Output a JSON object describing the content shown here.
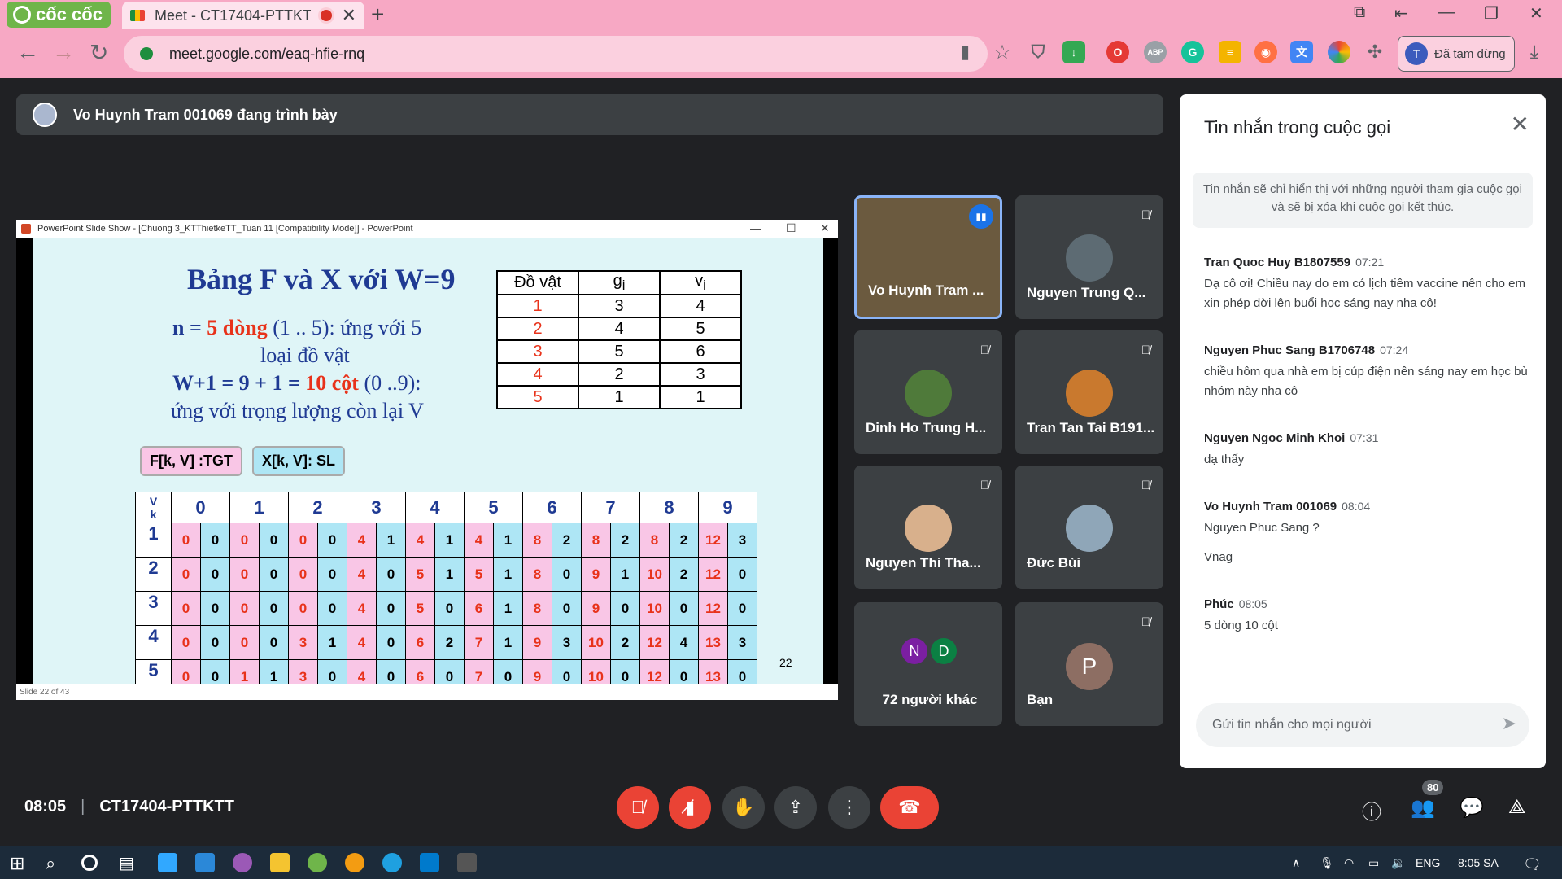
{
  "browser": {
    "brand": "cốc cốc",
    "tab_title": "Meet - CT17404-PTTKTT",
    "url": "meet.google.com/eaq-hfie-rnq",
    "profile_initial": "T",
    "profile_status": "Đã tạm dừng",
    "ext_abp": "ABP"
  },
  "meet": {
    "presenting": "Vo Huynh Tram 001069 đang trình bày",
    "time": "08:05",
    "meeting_code": "CT17404-PTTKTT",
    "participants_badge": "80"
  },
  "slide_window": {
    "title": "PowerPoint Slide Show - [Chuong 3_KTThietkeTT_Tuan 11 [Compatibility Mode]] - PowerPoint",
    "status": "Slide 22 of 43",
    "title_text": "Bảng F và X với W=9",
    "line1a": "n = ",
    "line1b": "5 dòng",
    "line1c": " (1 .. 5): ứng với 5",
    "line2": "loại đồ vật",
    "line3a": "W+1 = 9 + 1 = ",
    "line3b": "10 cột",
    "line3c": " (0 ..9):",
    "line4": "ứng với trọng lượng còn lại V",
    "callout_f": "F[k, V] :TGT",
    "callout_x": "X[k, V]: SL",
    "corner_v": "V",
    "corner_k": "k",
    "slide_number": "22",
    "items_header": [
      "Đồ vật",
      "g",
      "v"
    ],
    "items_sub": "i",
    "items": [
      [
        "1",
        "3",
        "4"
      ],
      [
        "2",
        "4",
        "5"
      ],
      [
        "3",
        "5",
        "6"
      ],
      [
        "4",
        "2",
        "3"
      ],
      [
        "5",
        "1",
        "1"
      ]
    ],
    "fx_cols": [
      "0",
      "1",
      "2",
      "3",
      "4",
      "5",
      "6",
      "7",
      "8",
      "9"
    ],
    "fx_rows": [
      {
        "k": "1",
        "cells": [
          "0",
          "0",
          "0",
          "0",
          "0",
          "0",
          "4",
          "1",
          "4",
          "1",
          "4",
          "1",
          "8",
          "2",
          "8",
          "2",
          "8",
          "2",
          "12",
          "3"
        ]
      },
      {
        "k": "2",
        "cells": [
          "0",
          "0",
          "0",
          "0",
          "0",
          "0",
          "4",
          "0",
          "5",
          "1",
          "5",
          "1",
          "8",
          "0",
          "9",
          "1",
          "10",
          "2",
          "12",
          "0"
        ]
      },
      {
        "k": "3",
        "cells": [
          "0",
          "0",
          "0",
          "0",
          "0",
          "0",
          "4",
          "0",
          "5",
          "0",
          "6",
          "1",
          "8",
          "0",
          "9",
          "0",
          "10",
          "0",
          "12",
          "0"
        ]
      },
      {
        "k": "4",
        "cells": [
          "0",
          "0",
          "0",
          "0",
          "3",
          "1",
          "4",
          "0",
          "6",
          "2",
          "7",
          "1",
          "9",
          "3",
          "10",
          "2",
          "12",
          "4",
          "13",
          "3"
        ]
      },
      {
        "k": "5",
        "cells": [
          "0",
          "0",
          "1",
          "1",
          "3",
          "0",
          "4",
          "0",
          "6",
          "0",
          "7",
          "0",
          "9",
          "0",
          "10",
          "0",
          "12",
          "0",
          "13",
          "0"
        ]
      }
    ]
  },
  "tiles": [
    {
      "name": "Vo Huynh Tram ...",
      "muted": false,
      "speaking": true
    },
    {
      "name": "Nguyen Trung Q...",
      "muted": true
    },
    {
      "name": "Dinh Ho Trung H...",
      "muted": true
    },
    {
      "name": "Tran Tan Tai B191...",
      "muted": true
    },
    {
      "name": "Nguyen Thi Tha...",
      "muted": true
    },
    {
      "name": "Đức Bùi",
      "muted": true
    },
    {
      "name": "72 người khác",
      "initials": [
        "N",
        "D"
      ]
    },
    {
      "name": "Bạn",
      "initial": "P",
      "muted": true
    }
  ],
  "chat": {
    "title": "Tin nhắn trong cuộc gọi",
    "notice": "Tin nhắn sẽ chỉ hiển thị với những người tham gia cuộc gọi và sẽ bị xóa khi cuộc gọi kết thúc.",
    "messages": [
      {
        "sender": "Tran Quoc Huy B1807559",
        "time": "07:21",
        "text": "Dạ cô ơi! Chiều nay do em có lịch tiêm vaccine nên cho em xin phép dời lên buổi học sáng nay nha cô!"
      },
      {
        "sender": "Nguyen Phuc Sang B1706748",
        "time": "07:24",
        "text": "chiều hôm qua nhà em bị cúp điện nên sáng nay em học bù nhóm này nha cô"
      },
      {
        "sender": "Nguyen Ngoc Minh Khoi",
        "time": "07:31",
        "text": "dạ thấy"
      },
      {
        "sender": "Vo Huynh Tram 001069",
        "time": "08:04",
        "text": "Nguyen Phuc Sang ?",
        "text2": "Vnag"
      },
      {
        "sender": "Phúc",
        "time": "08:05",
        "text": "5 dòng 10 cột"
      }
    ],
    "input_placeholder": "Gửi tin nhắn cho mọi người"
  },
  "taskbar": {
    "lang": "ENG",
    "clock": "8:05 SA"
  },
  "colors": {
    "tab_pink": "#f7a8c4",
    "meet_bg": "#202124",
    "red_btn": "#ea4335",
    "f_cell": "#f9c6e6",
    "x_cell": "#aee6f5"
  }
}
